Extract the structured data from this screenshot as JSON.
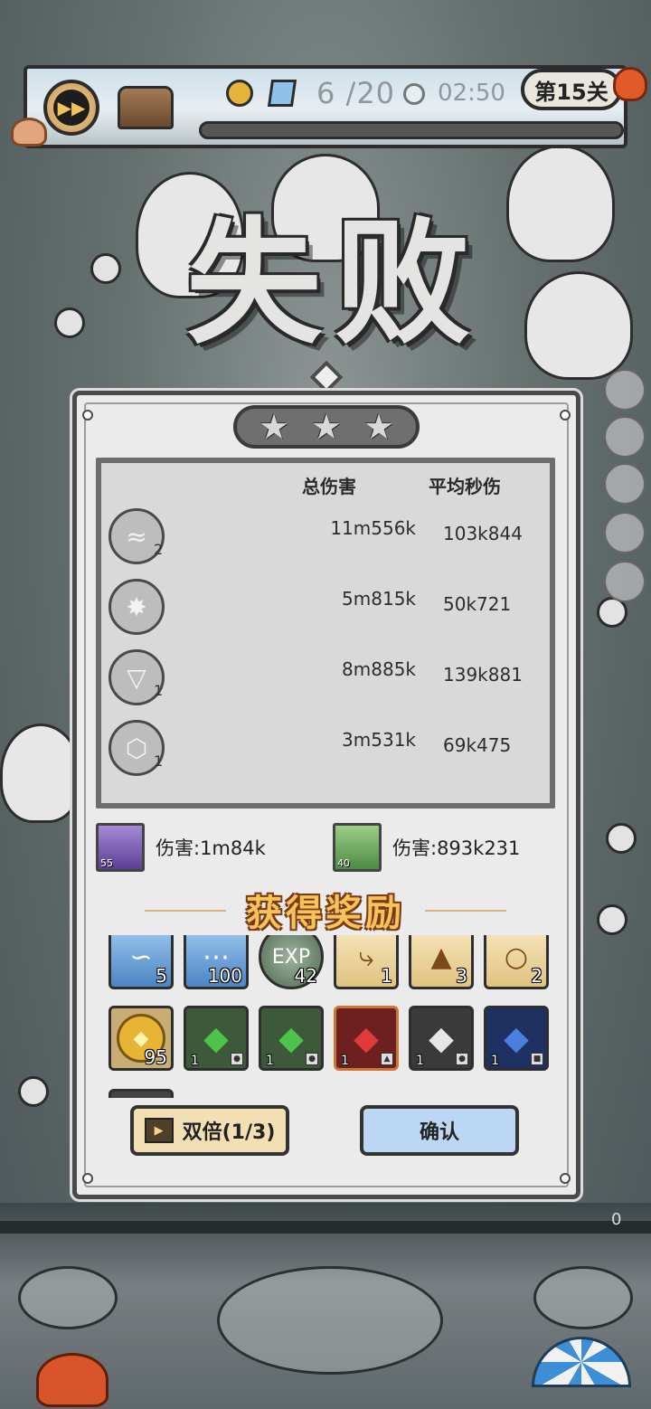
{
  "hud": {
    "wave": "6 /20",
    "timer": "02:50",
    "level": "第15关"
  },
  "result": {
    "title": "失败",
    "stars_total": 3,
    "stars_earned": 0
  },
  "stats": {
    "header_total": "总伤害",
    "header_dps": "平均秒伤",
    "rows": [
      {
        "icon": "tornado-icon",
        "level": "2",
        "total": "11m556k",
        "dps": "103k844"
      },
      {
        "icon": "crystal-burst-icon",
        "level": "",
        "total": "5m815k",
        "dps": "50k721"
      },
      {
        "icon": "drill-icon",
        "level": "1",
        "total": "8m885k",
        "dps": "139k881"
      },
      {
        "icon": "hexagon-stone-icon",
        "level": "1",
        "total": "3m531k",
        "dps": "69k475"
      }
    ]
  },
  "heroes": [
    {
      "level": "55",
      "damage": "伤害:1m84k",
      "color": "#8a5fc7"
    },
    {
      "level": "40",
      "damage": "伤害:893k231",
      "color": "#5c9a4e"
    }
  ],
  "rewards": {
    "title": "获得奖励",
    "row1": [
      {
        "icon": "blue-scroll-icon",
        "count": "5",
        "bg": "#5c95cf"
      },
      {
        "icon": "blue-scroll-icon",
        "count": "100",
        "bg": "#5c95cf"
      },
      {
        "icon": "exp-orb-icon",
        "count": "42",
        "bg": "#6d8a6d"
      },
      {
        "icon": "parchment-scroll-icon",
        "count": "1",
        "bg": "#f0dba9"
      },
      {
        "icon": "parchment-scroll-icon",
        "count": "3",
        "bg": "#f0dba9"
      },
      {
        "icon": "parchment-scroll-icon",
        "count": "2",
        "bg": "#f0dba9"
      }
    ],
    "row2": [
      {
        "icon": "gold-coin-icon",
        "count": "95",
        "bg": "#e0b23c"
      },
      {
        "icon": "green-gem-icon",
        "count": "1",
        "bg": "#3f7a3b"
      },
      {
        "icon": "green-gem-icon",
        "count": "1",
        "bg": "#3f7a3b"
      },
      {
        "icon": "red-gem-icon",
        "count": "1",
        "bg": "#8a2a2a"
      },
      {
        "icon": "white-gem-icon",
        "count": "1",
        "bg": "#4b4b4b"
      },
      {
        "icon": "blue-gem-icon",
        "count": "1",
        "bg": "#27417a"
      }
    ]
  },
  "buttons": {
    "double": "双倍(1/3)",
    "confirm": "确认"
  },
  "misc": {
    "counter": "0"
  }
}
